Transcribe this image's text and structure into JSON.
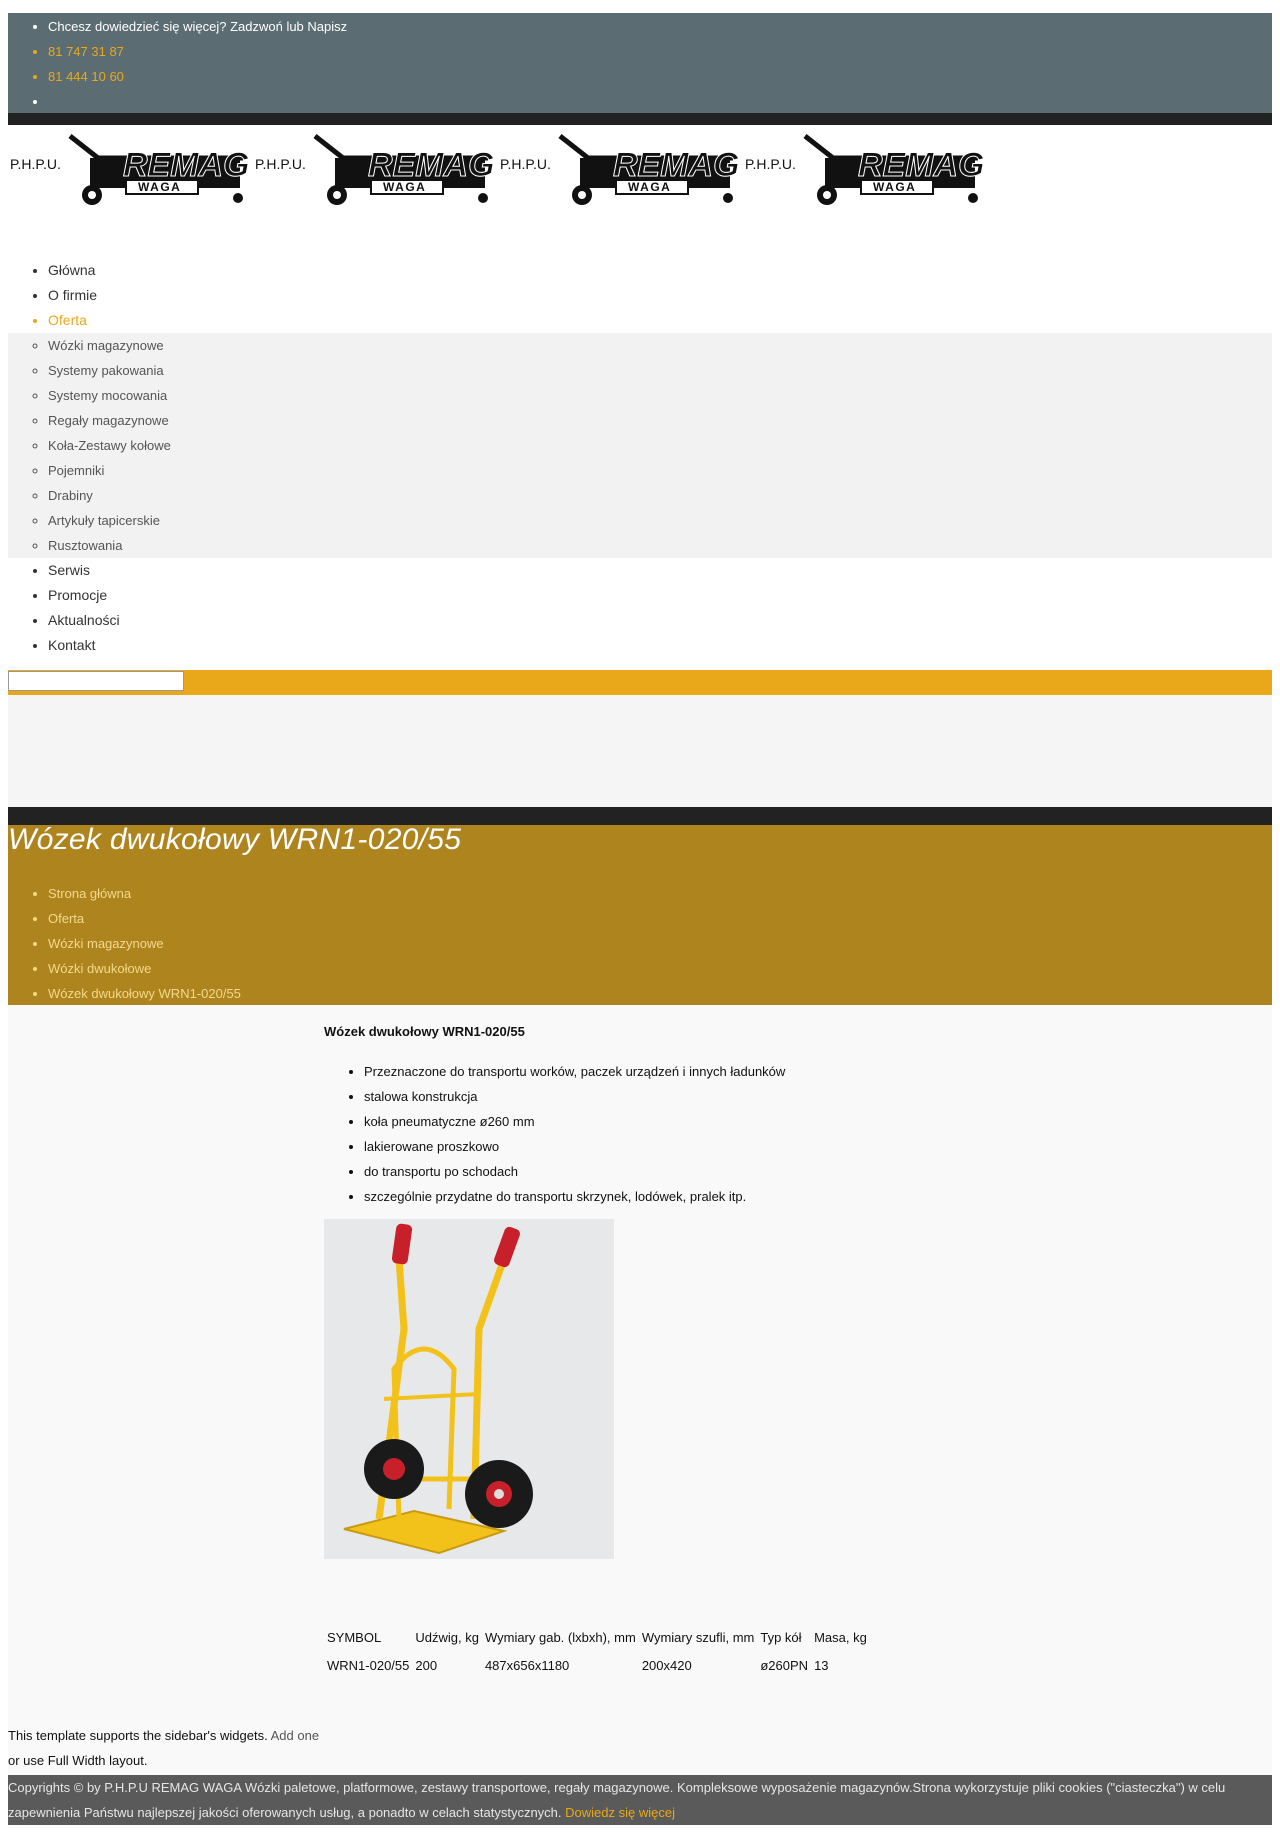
{
  "topbar": {
    "tagline": "Chcesz dowiedzieć się więcej? Zadzwoń lub Napisz",
    "phone1": "81 747 31 87",
    "phone2": "81 444 10 60",
    "empty_item": ""
  },
  "logo": {
    "prefix": "P.H.P.U.",
    "brand": "REMAG",
    "sub": "WAGA"
  },
  "menu": {
    "items": [
      "Główna",
      "O firmie",
      "Oferta",
      "Serwis",
      "Promocje",
      "Aktualności",
      "Kontakt"
    ],
    "active": "Oferta",
    "submenu": [
      "Wózki magazynowe",
      "Systemy pakowania",
      "Systemy mocowania",
      "Regały magazynowe",
      "Koła-Zestawy kołowe",
      "Pojemniki",
      "Drabiny",
      "Artykuły tapicerskie",
      "Rusztowania"
    ]
  },
  "search": {
    "value": "",
    "placeholder": ""
  },
  "page": {
    "title": "Wózek dwukołowy WRN1-020/55",
    "breadcrumbs": [
      "Strona główna",
      "Oferta",
      "Wózki magazynowe",
      "Wózki dwukołowe",
      "Wózek dwukołowy WRN1-020/55"
    ]
  },
  "product": {
    "heading": "Wózek dwukołowy WRN1-020/55",
    "features": [
      "Przeznaczone do transportu worków, paczek urządzeń i innych ładunków",
      "stalowa konstrukcja",
      "koła pneumatyczne ø260 mm",
      "lakierowane proszkowo",
      "do transportu po schodach",
      "szczególnie przydatne do transportu skrzynek, lodówek, pralek itp."
    ],
    "image_icon": "hand-truck-photo",
    "table": {
      "headers": [
        "SYMBOL",
        "Udźwig, kg",
        "Wymiary gab. (lxbxh), mm",
        "Wymiary szufli, mm",
        "Typ kół",
        "Masa, kg"
      ],
      "row": [
        "WRN1-020/55",
        "200",
        "487x656x1180",
        "200x420",
        "ø260PN",
        "13"
      ]
    }
  },
  "sidebar": {
    "text1": "This template supports the sidebar's widgets.",
    "link1": "Add one",
    "text2": "or use Full Width layout."
  },
  "footer": {
    "text": "Copyrights © by P.H.P.U REMAG WAGA Wózki paletowe, platformowe, zestawy transportowe, regały magazynowe. Kompleksowe wyposażenie magazynów.Strona wykorzystuje pliki cookies (\"ciasteczka\") w celu zapewnienia Państwu najlepszej jakości oferowanych usług, a ponadto w celach statystycznych.",
    "more_link": "Dowiedz się więcej"
  },
  "colors": {
    "topbar": "#5c6c73",
    "accent": "#e8a819",
    "banner": "#ae841e",
    "footer": "#5a5a5a",
    "dark": "#222222"
  }
}
